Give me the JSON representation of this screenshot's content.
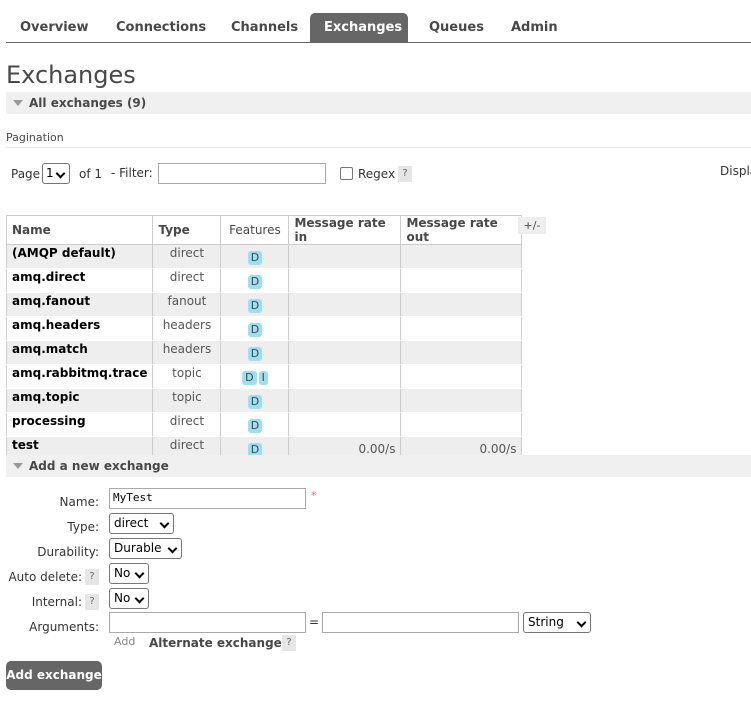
{
  "nav": {
    "tabs": [
      "Overview",
      "Connections",
      "Channels",
      "Exchanges",
      "Queues",
      "Admin"
    ],
    "active": "Exchanges"
  },
  "page_title": "Exchanges",
  "all_exchanges": {
    "title": "All exchanges",
    "count": "(9)"
  },
  "pagination": {
    "label": "Pagination",
    "page_label": "Page",
    "page_value": "1",
    "of_label": "of 1",
    "filter_label": "- Filter:",
    "filter_value": "",
    "regex_label": "Regex",
    "regex_help": "?",
    "display_label": "Displa"
  },
  "table": {
    "headers": [
      "Name",
      "Type",
      "Features",
      "Message rate in",
      "Message rate out"
    ],
    "cols_toggle": "+/-",
    "rows": [
      {
        "name": "(AMQP default)",
        "type": "direct",
        "features": [
          "D"
        ],
        "rate_in": "",
        "rate_out": ""
      },
      {
        "name": "amq.direct",
        "type": "direct",
        "features": [
          "D"
        ],
        "rate_in": "",
        "rate_out": ""
      },
      {
        "name": "amq.fanout",
        "type": "fanout",
        "features": [
          "D"
        ],
        "rate_in": "",
        "rate_out": ""
      },
      {
        "name": "amq.headers",
        "type": "headers",
        "features": [
          "D"
        ],
        "rate_in": "",
        "rate_out": ""
      },
      {
        "name": "amq.match",
        "type": "headers",
        "features": [
          "D"
        ],
        "rate_in": "",
        "rate_out": ""
      },
      {
        "name": "amq.rabbitmq.trace",
        "type": "topic",
        "features": [
          "D",
          "I"
        ],
        "rate_in": "",
        "rate_out": ""
      },
      {
        "name": "amq.topic",
        "type": "topic",
        "features": [
          "D"
        ],
        "rate_in": "",
        "rate_out": ""
      },
      {
        "name": "processing",
        "type": "direct",
        "features": [
          "D"
        ],
        "rate_in": "",
        "rate_out": ""
      },
      {
        "name": "test",
        "type": "direct",
        "features": [
          "D"
        ],
        "rate_in": "0.00/s",
        "rate_out": "0.00/s"
      }
    ]
  },
  "add_exchange": {
    "title": "Add a new exchange",
    "name_label": "Name:",
    "name_value": "MyTest",
    "required_mark": "*",
    "type_label": "Type:",
    "type_value": "direct",
    "durability_label": "Durability:",
    "durability_value": "Durable",
    "auto_delete_label": "Auto delete:",
    "auto_delete_value": "No",
    "internal_label": "Internal:",
    "internal_value": "No",
    "help": "?",
    "arguments_label": "Arguments:",
    "arg_key": "",
    "equals": "=",
    "arg_value": "",
    "arg_type": "String",
    "add_label": "Add",
    "alternate_exchange": "Alternate exchange",
    "submit_label": "Add exchange"
  },
  "colors": {
    "tab_active_bg": "#666666",
    "section_bg": "#f0f0f0",
    "row_alt_bg": "#eeeeee",
    "badge_bg": "#9cdff0",
    "button_bg": "#666666",
    "required": "#ff6666"
  }
}
